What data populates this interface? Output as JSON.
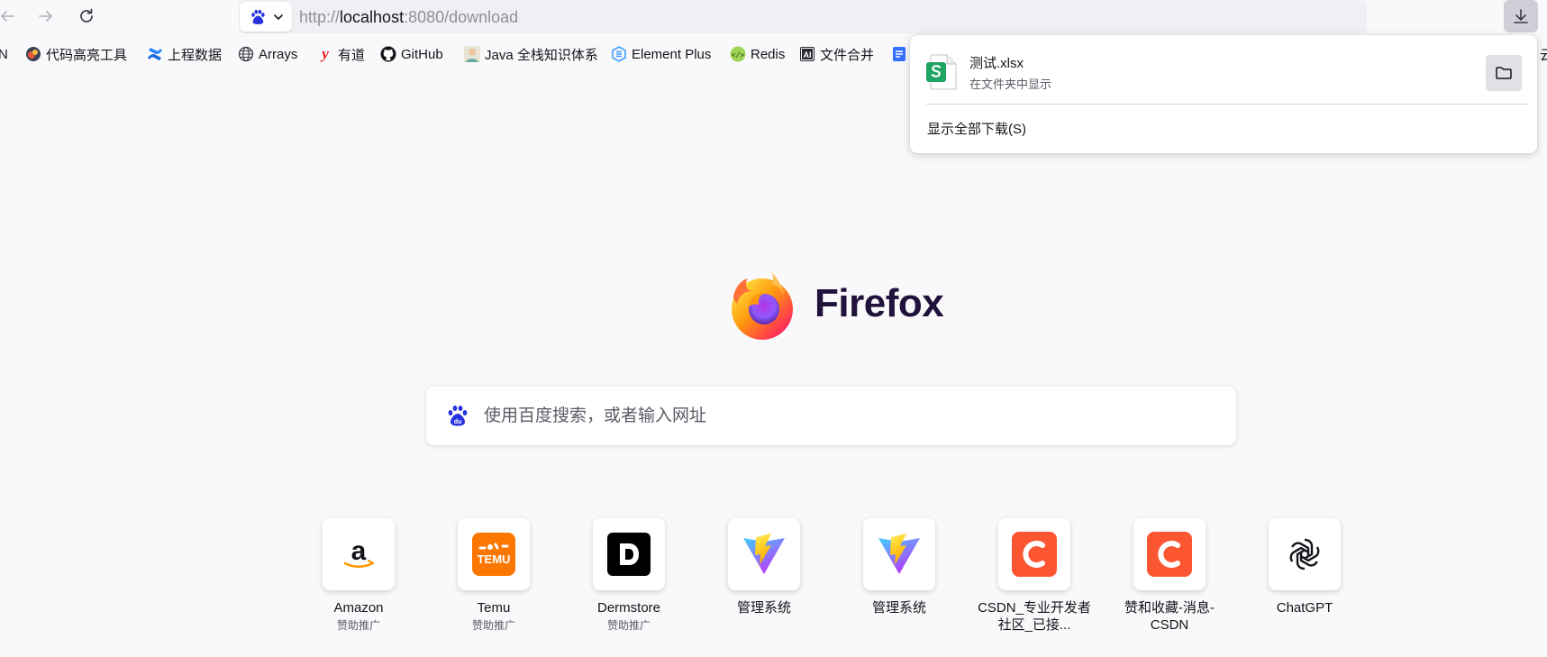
{
  "urlbar": {
    "protocol": "http://",
    "host": "localhost",
    "rest": ":8080/download"
  },
  "bookmarks": [
    {
      "label": "N",
      "icon": "csdn-icon"
    },
    {
      "label": "代码高亮工具",
      "icon": "codehighlight-icon"
    },
    {
      "label": "上程数据",
      "icon": "confluence-icon"
    },
    {
      "label": "Arrays",
      "icon": "globe-icon"
    },
    {
      "label": "有道",
      "icon": "youdao-icon"
    },
    {
      "label": "GitHub",
      "icon": "github-icon"
    },
    {
      "label": "Java 全栈知识体系",
      "icon": "java-avatar-icon"
    },
    {
      "label": "Element Plus",
      "icon": "element-plus-icon"
    },
    {
      "label": "Redis",
      "icon": "redis-icon"
    },
    {
      "label": "文件合并",
      "icon": "ai-icon"
    },
    {
      "label": "",
      "icon": "doc-icon"
    },
    {
      "label": "云",
      "icon": ""
    }
  ],
  "download_panel": {
    "file_name": "测试.xlsx",
    "status": "在文件夹中显示",
    "show_all": "显示全部下载(S)"
  },
  "logo": {
    "wordmark": "Firefox"
  },
  "search": {
    "placeholder": "使用百度搜索，或者输入网址"
  },
  "top_sites": [
    {
      "title": "Amazon",
      "sponsor": "赞助推广",
      "icon": "amazon-icon"
    },
    {
      "title": "Temu",
      "sponsor": "赞助推广",
      "icon": "temu-icon"
    },
    {
      "title": "Dermstore",
      "sponsor": "赞助推广",
      "icon": "dermstore-icon"
    },
    {
      "title": "管理系统",
      "sponsor": "",
      "icon": "vite-icon"
    },
    {
      "title": "管理系统",
      "sponsor": "",
      "icon": "vite-icon"
    },
    {
      "title": "CSDN_专业开发者社区_已接...",
      "sponsor": "",
      "icon": "csdn-icon"
    },
    {
      "title": "赞和收藏-消息-CSDN",
      "sponsor": "",
      "icon": "csdn-icon"
    },
    {
      "title": "ChatGPT",
      "sponsor": "",
      "icon": "chatgpt-icon"
    }
  ],
  "colors": {
    "page_background": "#f9f9fb",
    "toolbar_field": "#f0f0f4",
    "wordmark": "#20123a",
    "csdn_red": "#fc5531",
    "temu_orange": "#fb7701",
    "excel_green": "#1fa463"
  }
}
